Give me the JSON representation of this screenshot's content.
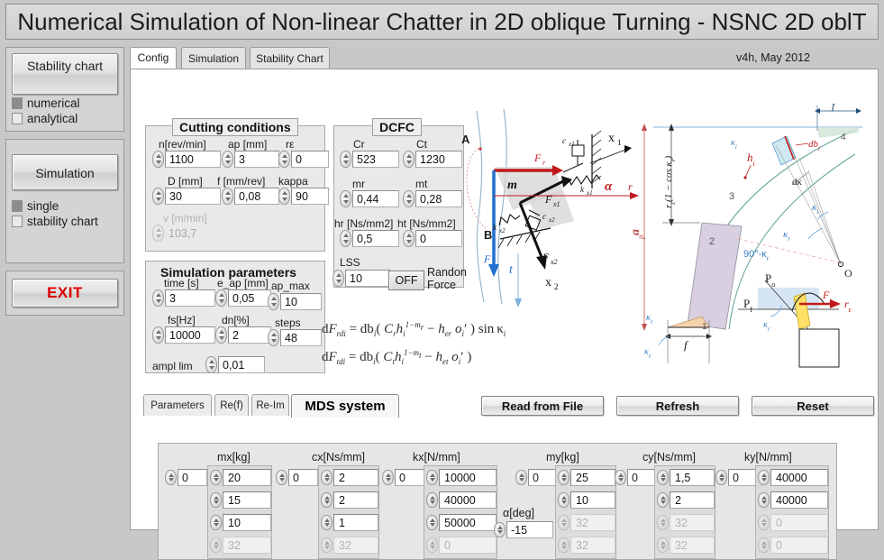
{
  "window": {
    "title": "Numerical Simulation of Non-linear Chatter in  2D oblique Turning - NSNC 2D oblT"
  },
  "sidebar": {
    "stability_chart_button": "Stability chart",
    "stability_options": [
      {
        "label": "numerical",
        "selected": true
      },
      {
        "label": "analytical",
        "selected": false
      }
    ],
    "simulation_button": "Simulation",
    "simulation_options": [
      {
        "label": "single",
        "selected": true
      },
      {
        "label": "stability chart",
        "selected": false
      }
    ],
    "exit_button": "EXIT"
  },
  "tabs": [
    {
      "label": "Config",
      "active": true
    },
    {
      "label": "Simulation",
      "active": false
    },
    {
      "label": "Stability Chart",
      "active": false
    }
  ],
  "version_label": "v4h, May 2012",
  "cutting_conditions": {
    "title": "Cutting conditions",
    "fields": [
      {
        "label": "n[rev/min]",
        "value": "1100",
        "dim": false
      },
      {
        "label": "ap [mm]",
        "value": "3",
        "dim": false
      },
      {
        "label": "rε",
        "value": "0",
        "dim": false
      },
      {
        "label": "D [mm]",
        "value": "30",
        "dim": false
      },
      {
        "label": "f [mm/rev]",
        "value": "0,08",
        "dim": false
      },
      {
        "label": "kappa",
        "value": "90",
        "dim": false
      },
      {
        "label": "v [m/min]",
        "value": "103,7",
        "dim": true
      }
    ]
  },
  "dcfc": {
    "title": "DCFC",
    "fields": [
      {
        "label": "Cr",
        "value": "523"
      },
      {
        "label": "Ct",
        "value": "1230"
      },
      {
        "label": "mr",
        "value": "0,44"
      },
      {
        "label": "mt",
        "value": "0,28"
      },
      {
        "label": "hr [Ns/mm2]",
        "value": "0,5"
      },
      {
        "label": "ht [Ns/mm2]",
        "value": "0"
      },
      {
        "label": "LSS",
        "value": "10"
      }
    ],
    "random_force_toggle": "OFF",
    "random_force_label": "Randon Force"
  },
  "simulation_parameters": {
    "title": "Simulation parameters",
    "fields": [
      {
        "label": "time  [s]",
        "value": "3"
      },
      {
        "label": "e_ap [mm]",
        "value": "0,05"
      },
      {
        "label": "ap_max",
        "value": "10"
      },
      {
        "label": "fs[Hz]",
        "value": "10000"
      },
      {
        "label": "dn[%]",
        "value": "2"
      },
      {
        "label": "steps",
        "value": "48"
      },
      {
        "label": "ampl lim",
        "value": "0,01"
      }
    ]
  },
  "equations": {
    "radial": "dF_rdi = db_i( C_r h_i^(1-m_r) - h_er o_i' ) sin κ_i",
    "tangential": "dF_tdi = db_i( C_t h_i^(1-m_t) - h_et o_i' )"
  },
  "diagram_forces": {
    "labels": [
      "A",
      "B",
      "m",
      "F_r",
      "F_t",
      "F_x1",
      "F_x2",
      "c_x1",
      "k_x1",
      "c_x2",
      "k_x2",
      "x_1",
      "x_2",
      "t",
      "r",
      "α"
    ]
  },
  "diagram_geometry": {
    "labels": [
      "f",
      "a_p",
      "r_ε(1 - cos κ_r)",
      "h_i",
      "db_i",
      "dκ",
      "κ_i",
      "κ_r",
      "90°-κ_r",
      "O",
      "P_o",
      "P_f",
      "F_r",
      "r_ε",
      "1",
      "2",
      "3",
      "4"
    ]
  },
  "subtabs": [
    {
      "label": "Parameters",
      "active": false
    },
    {
      "label": "Re(f)",
      "active": false
    },
    {
      "label": "Re-Im",
      "active": false
    },
    {
      "label": "MDS system",
      "active": true
    }
  ],
  "action_buttons": [
    {
      "label": "Read from File"
    },
    {
      "label": "Refresh"
    },
    {
      "label": "Reset"
    }
  ],
  "mds_system": {
    "alpha_label": "α[deg]",
    "alpha_value": "-15",
    "columns": [
      {
        "header": "mx[kg]",
        "index": "0",
        "values": [
          {
            "v": "20",
            "dim": false
          },
          {
            "v": "15",
            "dim": false
          },
          {
            "v": "10",
            "dim": false
          },
          {
            "v": "32",
            "dim": true
          }
        ]
      },
      {
        "header": "cx[Ns/mm]",
        "index": "0",
        "values": [
          {
            "v": "2",
            "dim": false
          },
          {
            "v": "2",
            "dim": false
          },
          {
            "v": "1",
            "dim": false
          },
          {
            "v": "32",
            "dim": true
          }
        ]
      },
      {
        "header": "kx[N/mm]",
        "index": "0",
        "values": [
          {
            "v": "10000",
            "dim": false
          },
          {
            "v": "40000",
            "dim": false
          },
          {
            "v": "50000",
            "dim": false
          },
          {
            "v": "0",
            "dim": true
          }
        ]
      },
      {
        "header": "my[kg]",
        "index": "0",
        "values": [
          {
            "v": "25",
            "dim": false
          },
          {
            "v": "10",
            "dim": false
          },
          {
            "v": "32",
            "dim": true
          },
          {
            "v": "32",
            "dim": true
          }
        ]
      },
      {
        "header": "cy[Ns/mm]",
        "index": "0",
        "values": [
          {
            "v": "1,5",
            "dim": false
          },
          {
            "v": "2",
            "dim": false
          },
          {
            "v": "32",
            "dim": true
          },
          {
            "v": "32",
            "dim": true
          }
        ]
      },
      {
        "header": "ky[N/mm]",
        "index": "0",
        "values": [
          {
            "v": "40000",
            "dim": false
          },
          {
            "v": "40000",
            "dim": false
          },
          {
            "v": "0",
            "dim": true
          },
          {
            "v": "0",
            "dim": true
          }
        ]
      }
    ]
  },
  "colors": {
    "window_bg": "#c8c8c8",
    "panel_bg": "#e9e9e9",
    "exit_red": "#dd0000",
    "force_red": "#c01a1a",
    "force_blue": "#1f6fd0"
  }
}
